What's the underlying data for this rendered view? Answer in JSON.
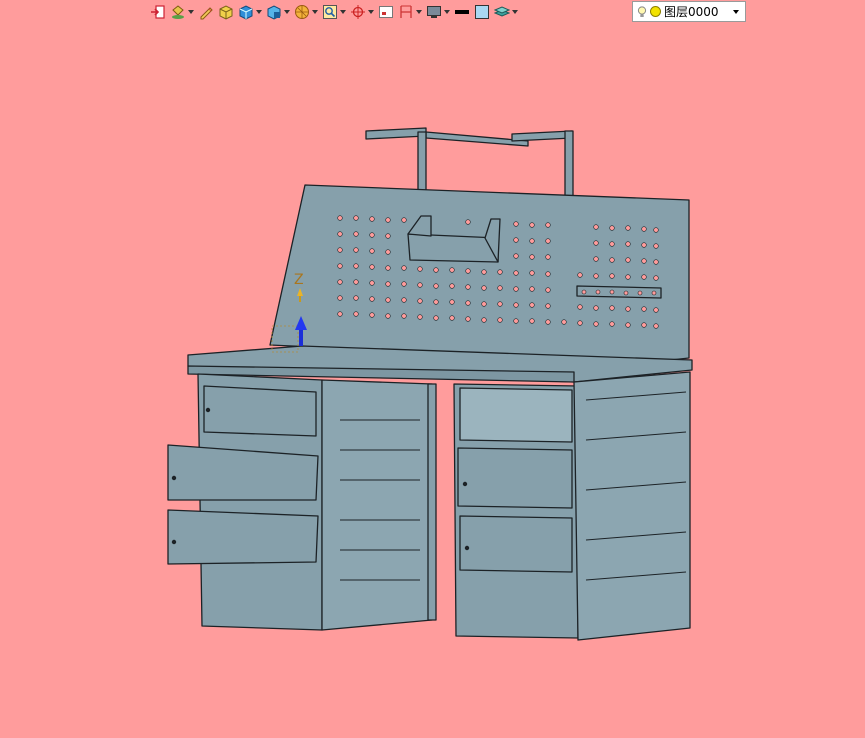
{
  "toolbar": {
    "buttons": [
      {
        "icon": "exit-door-icon",
        "dropdown": false
      },
      {
        "icon": "paint-bucket-icon",
        "dropdown": true
      },
      {
        "icon": "pencil-icon",
        "dropdown": false
      },
      {
        "icon": "shaded-cube-icon",
        "dropdown": false
      },
      {
        "icon": "blue-cube-icon",
        "dropdown": true
      },
      {
        "icon": "section-cube-icon",
        "dropdown": true
      },
      {
        "icon": "render-sphere-icon",
        "dropdown": true
      },
      {
        "icon": "zoom-frame-icon",
        "dropdown": true
      },
      {
        "icon": "crosshair-icon",
        "dropdown": true
      },
      {
        "icon": "window-icon",
        "dropdown": false
      },
      {
        "icon": "dimension-icon",
        "dropdown": true
      },
      {
        "icon": "monitor-icon",
        "dropdown": true
      },
      {
        "icon": "line-weight-icon",
        "dropdown": false
      },
      {
        "icon": "fill-color-icon",
        "dropdown": false
      },
      {
        "icon": "layers-icon",
        "dropdown": true
      }
    ],
    "layer_name": "图层0000"
  },
  "viewport": {
    "background_color": "#ff9c9c",
    "model_color": "#86a0ab",
    "axis_label": "Z"
  }
}
